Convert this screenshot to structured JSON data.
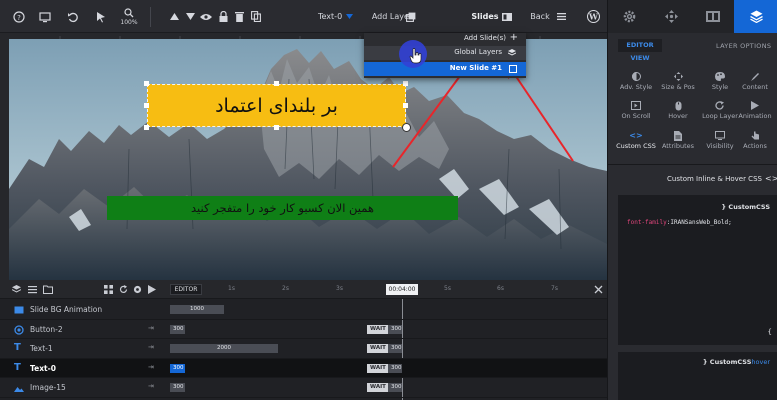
{
  "toolbar": {
    "zoom": "100%",
    "layer_name": "Text-0",
    "add_layer": "Add Layer",
    "slides": "Slides",
    "back": "Back"
  },
  "slides_menu": {
    "add_slides": "Add Slide(s)",
    "global_layers": "Global Layers",
    "new_slide": "New Slide #1"
  },
  "canvas": {
    "title_text": "بر بلندای اعتماد",
    "subtitle_text": "همین الان کسبو کار خود را متفجر کنید"
  },
  "right_panel": {
    "editor_view": "EDITOR VIEW",
    "layer_options": "LAYER OPTIONS",
    "options": [
      {
        "label": "Adv. Style",
        "icon": "adv-style-icon"
      },
      {
        "label": "Size & Pos",
        "icon": "size-pos-icon"
      },
      {
        "label": "Style",
        "icon": "palette-icon"
      },
      {
        "label": "Content",
        "icon": "content-icon"
      },
      {
        "label": "On Scroll",
        "icon": "on-scroll-icon"
      },
      {
        "label": "Hover",
        "icon": "mouse-icon"
      },
      {
        "label": "Loop Layer",
        "icon": "loop-icon"
      },
      {
        "label": "Animation",
        "icon": "play-icon"
      },
      {
        "label": "Custom CSS",
        "icon": "code-icon"
      },
      {
        "label": "Attributes",
        "icon": "attributes-icon"
      },
      {
        "label": "Visibility",
        "icon": "eye-icon"
      },
      {
        "label": "Actions",
        "icon": "actions-icon"
      }
    ],
    "css_header": "Custom Inline & Hover CSS",
    "css_block_title": "} CustomCSS",
    "css_code_prop": "font-family",
    "css_code_value": ":IRANSansWeb_Bold;",
    "css_close": "{",
    "hover_title": "} CustomCSS",
    "hover_suffix": "hover"
  },
  "timeline": {
    "editor_tab": "EDITOR",
    "current_time": "00:04:00",
    "ticks": [
      "1s",
      "2s",
      "3s",
      "5s",
      "6s",
      "7s"
    ],
    "wait_label": "WAIT",
    "rows": [
      {
        "name": "Slide BG Animation",
        "bar": "1000",
        "wait": ""
      },
      {
        "name": "Button-2",
        "bar": "300",
        "wait": "300"
      },
      {
        "name": "Text-1",
        "bar": "2000",
        "wait": "300"
      },
      {
        "name": "Text-0",
        "bar": "300",
        "wait": "300"
      },
      {
        "name": "Image-15",
        "bar": "300",
        "wait": "300"
      }
    ]
  },
  "colors": {
    "accent": "#1467d6",
    "title_bg": "#f7bd12",
    "subtitle_bg": "#0f7f16",
    "arrow": "#e8252a"
  }
}
